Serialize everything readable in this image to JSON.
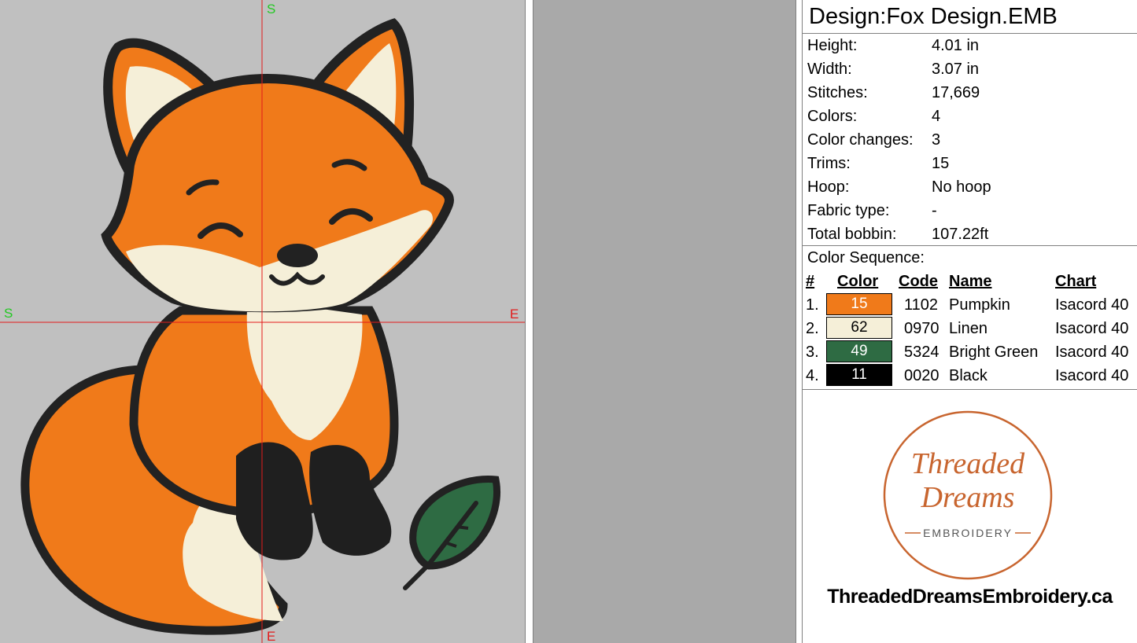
{
  "canvas": {
    "markers": {
      "top_start": "S",
      "left_start": "S",
      "right_end": "E",
      "bottom_end": "E"
    }
  },
  "panel": {
    "design_title": "Design:Fox Design.EMB",
    "stats": [
      {
        "label": "Height:",
        "value": "4.01 in"
      },
      {
        "label": "Width:",
        "value": "3.07 in"
      },
      {
        "label": "Stitches:",
        "value": "17,669"
      },
      {
        "label": "Colors:",
        "value": "4"
      },
      {
        "label": "Color changes:",
        "value": "3"
      },
      {
        "label": "Trims:",
        "value": "15"
      },
      {
        "label": "Hoop:",
        "value": "No hoop"
      },
      {
        "label": "Fabric type:",
        "value": "-"
      },
      {
        "label": "Total bobbin:",
        "value": "107.22ft"
      }
    ],
    "color_sequence_title": "Color Sequence:",
    "headers": {
      "num": "#",
      "color": "Color",
      "code": "Code",
      "name": "Name",
      "chart": "Chart"
    },
    "colors": [
      {
        "num": "1.",
        "swatch": "15",
        "code": "1102",
        "name": "Pumpkin",
        "chart": "Isacord 40",
        "hex": "#f07a1a",
        "text": "#ffffff"
      },
      {
        "num": "2.",
        "swatch": "62",
        "code": "0970",
        "name": "Linen",
        "chart": "Isacord 40",
        "hex": "#f5efd8",
        "text": "#000000"
      },
      {
        "num": "3.",
        "swatch": "49",
        "code": "5324",
        "name": "Bright Green",
        "chart": "Isacord 40",
        "hex": "#2e6b43",
        "text": "#ffffff"
      },
      {
        "num": "4.",
        "swatch": "11",
        "code": "0020",
        "name": "Black",
        "chart": "Isacord 40",
        "hex": "#000000",
        "text": "#ffffff"
      }
    ],
    "logo": {
      "line1": "Threaded",
      "line2": "Dreams",
      "line3": "EMBROIDERY",
      "color": "#c8652f"
    },
    "website": "ThreadedDreamsEmbroidery.ca"
  }
}
